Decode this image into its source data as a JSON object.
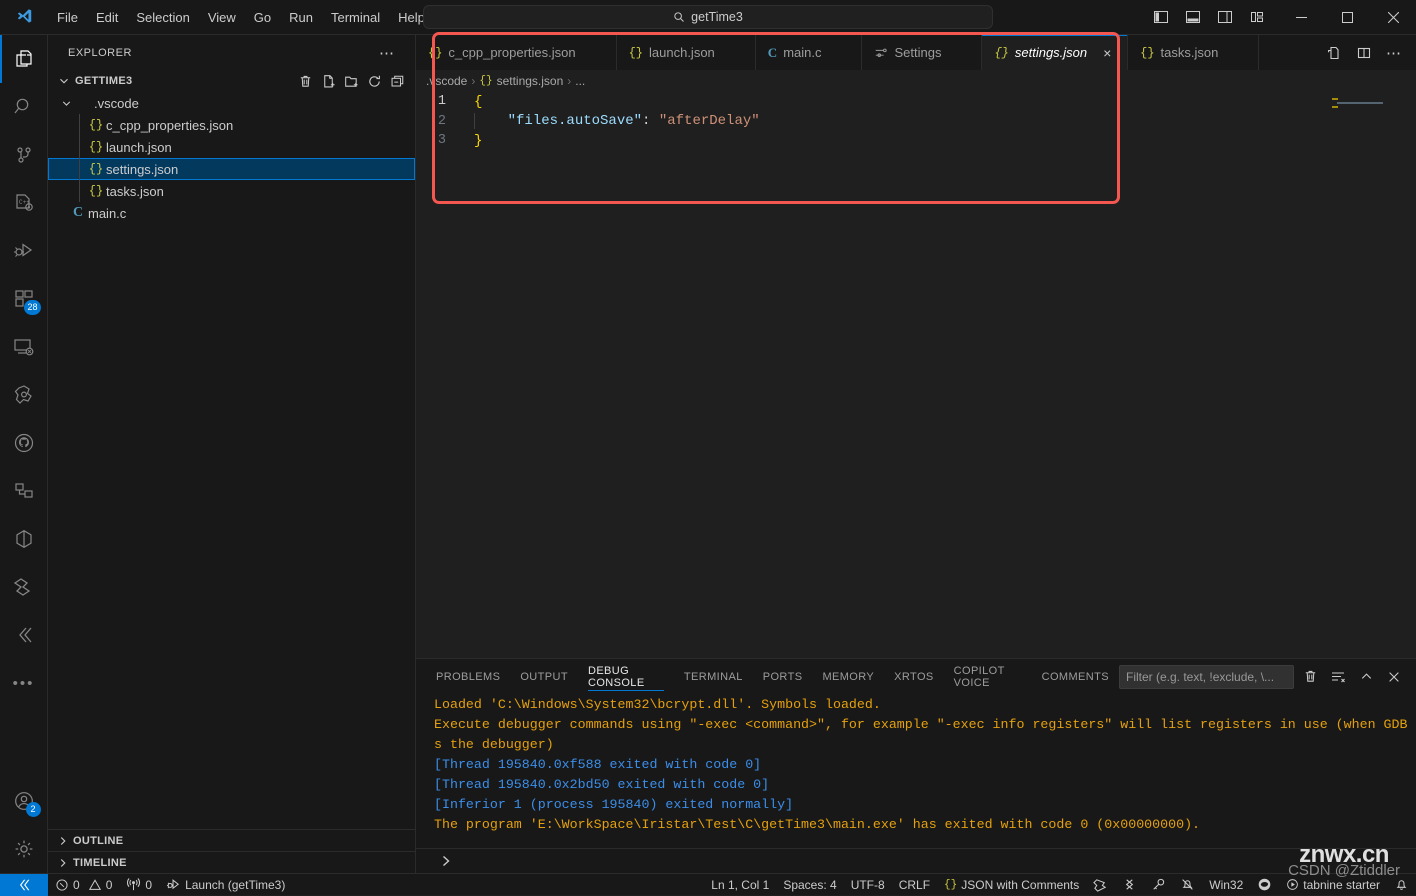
{
  "titlebar": {
    "menus": [
      "File",
      "Edit",
      "Selection",
      "View",
      "Go",
      "Run",
      "Terminal",
      "Help"
    ],
    "back_icon": "arrow-left-icon",
    "forward_icon": "arrow-right-icon",
    "command_center_text": "getTime3",
    "layout_icons": [
      "toggle-primary-sidebar-icon",
      "toggle-panel-icon",
      "toggle-secondary-sidebar-icon",
      "customize-layout-icon"
    ],
    "window_controls": [
      "minimize",
      "maximize",
      "close"
    ]
  },
  "activitybar": {
    "items": [
      {
        "name": "explorer",
        "icon": "files-icon",
        "active": true,
        "badge": ""
      },
      {
        "name": "search",
        "icon": "search-icon",
        "active": false,
        "badge": ""
      },
      {
        "name": "source-control",
        "icon": "source-control-icon",
        "active": false,
        "badge": ""
      },
      {
        "name": "cpp-config",
        "icon": "cpp-gear-icon",
        "active": false,
        "badge": ""
      },
      {
        "name": "run-and-debug",
        "icon": "debug-play-icon",
        "active": false,
        "badge": ""
      },
      {
        "name": "extensions",
        "icon": "extensions-icon",
        "active": false,
        "badge": "28"
      },
      {
        "name": "remote-explorer",
        "icon": "remote-monitor-icon",
        "active": false,
        "badge": ""
      },
      {
        "name": "platformio",
        "icon": "platformio-icon",
        "active": false,
        "badge": ""
      },
      {
        "name": "github",
        "icon": "github-icon",
        "active": false,
        "badge": ""
      },
      {
        "name": "project-manager",
        "icon": "project-manager-icon",
        "active": false,
        "badge": ""
      },
      {
        "name": "docker",
        "icon": "cube-icon",
        "active": false,
        "badge": ""
      },
      {
        "name": "serial-monitor",
        "icon": "serial-monitor-icon",
        "active": false,
        "badge": ""
      },
      {
        "name": "embedded-tools",
        "icon": "embedded-tools-icon",
        "active": false,
        "badge": ""
      },
      {
        "name": "more-views",
        "icon": "ellipsis-icon",
        "active": false,
        "badge": ""
      }
    ],
    "bottom": [
      {
        "name": "accounts",
        "icon": "account-icon",
        "badge": "2"
      },
      {
        "name": "manage",
        "icon": "gear-icon",
        "badge": ""
      }
    ]
  },
  "sidebar": {
    "title": "EXPLORER",
    "more_actions_icon": "ellipsis-icon",
    "root": {
      "label": "GETTIME3",
      "expanded": true,
      "actions": [
        "trash-icon",
        "new-file-icon",
        "new-folder-icon",
        "refresh-icon",
        "collapse-all-icon"
      ]
    },
    "tree": [
      {
        "label": ".vscode",
        "type": "folder",
        "depth": 1,
        "expanded": true,
        "selected": false
      },
      {
        "label": "c_cpp_properties.json",
        "type": "json",
        "depth": 2,
        "selected": false
      },
      {
        "label": "launch.json",
        "type": "json",
        "depth": 2,
        "selected": false
      },
      {
        "label": "settings.json",
        "type": "json",
        "depth": 2,
        "selected": true
      },
      {
        "label": "tasks.json",
        "type": "json",
        "depth": 2,
        "selected": false
      },
      {
        "label": "main.c",
        "type": "c",
        "depth": 1,
        "selected": false
      }
    ],
    "collapsed_sections": [
      {
        "label": "OUTLINE"
      },
      {
        "label": "TIMELINE"
      }
    ]
  },
  "editor": {
    "tabs": [
      {
        "label": "c_cpp_properties.json",
        "kind": "json",
        "active": false,
        "dirty": false
      },
      {
        "label": "launch.json",
        "kind": "json",
        "active": false,
        "dirty": false
      },
      {
        "label": "main.c",
        "kind": "c",
        "active": false,
        "dirty": false
      },
      {
        "label": "Settings",
        "kind": "settings",
        "active": false,
        "dirty": false
      },
      {
        "label": "settings.json",
        "kind": "json",
        "active": true,
        "dirty": false
      },
      {
        "label": "tasks.json",
        "kind": "json",
        "active": false,
        "dirty": false
      }
    ],
    "tab_close_label": "×",
    "tab_actions": [
      "split-editor-right-icon",
      "split-editor-icon",
      "more-actions-icon"
    ],
    "breadcrumbs": [
      ".vscode",
      "settings.json",
      "..."
    ],
    "breadcrumb_file_icon": "json-braces-icon",
    "code_lines": [
      {
        "num": "1",
        "tokens": [
          {
            "t": "{",
            "c": "tok-brace-y"
          }
        ]
      },
      {
        "num": "2",
        "tokens": [
          {
            "t": "    ",
            "c": "tok-punc"
          },
          {
            "t": "\"files.autoSave\"",
            "c": "tok-key"
          },
          {
            "t": ": ",
            "c": "tok-punc"
          },
          {
            "t": "\"afterDelay\"",
            "c": "tok-str"
          }
        ]
      },
      {
        "num": "3",
        "tokens": [
          {
            "t": "}",
            "c": "tok-brace-y"
          }
        ]
      }
    ]
  },
  "panel": {
    "tabs": [
      "PROBLEMS",
      "OUTPUT",
      "DEBUG CONSOLE",
      "TERMINAL",
      "PORTS",
      "MEMORY",
      "XRTOS",
      "COPILOT VOICE",
      "COMMENTS"
    ],
    "active_tab": "DEBUG CONSOLE",
    "filter_placeholder": "Filter (e.g. text, !exclude, \\...",
    "actions": [
      "clear-console-icon",
      "filter-icon",
      "chevron-up-icon",
      "close-icon"
    ],
    "console_lines": [
      {
        "text": "Loaded 'C:\\Windows\\System32\\bcrypt.dll'. Symbols loaded.",
        "color": "amber"
      },
      {
        "text": "Execute debugger commands using \"-exec <command>\", for example \"-exec info registers\" will list registers in use (when GDB i",
        "color": "amber"
      },
      {
        "text": "s the debugger)",
        "color": "amber"
      },
      {
        "text": "[Thread 195840.0xf588 exited with code 0]",
        "color": "blue"
      },
      {
        "text": "[Thread 195840.0x2bd50 exited with code 0]",
        "color": "blue"
      },
      {
        "text": "[Inferior 1 (process 195840) exited normally]",
        "color": "blue"
      },
      {
        "text": "The program 'E:\\WorkSpace\\Iristar\\Test\\C\\getTime3\\main.exe' has exited with code 0 (0x00000000).",
        "color": "amber"
      }
    ],
    "prompt_icon": "chevron-right-icon"
  },
  "statusbar": {
    "remote_icon": "remote-window-icon",
    "errors": "0",
    "warnings": "0",
    "radio_tower": "0",
    "launch_label": "Launch (getTime3)",
    "right": {
      "cursor": "Ln 1, Col 1",
      "indentation": "Spaces: 4",
      "encoding": "UTF-8",
      "eol": "CRLF",
      "language": "JSON with Comments",
      "platform": "Win32",
      "tabnine": "tabnine starter",
      "icons": [
        "prettier-icon",
        "sync-icon",
        "key-icon",
        "bell-slash-icon",
        "edge-icon",
        "tabnine-icon",
        "bell-icon"
      ]
    }
  },
  "annotation": {
    "color": "#f4574f",
    "shape": "rounded-rectangle"
  },
  "watermark": {
    "line1": "znwx.cn",
    "line2": "CSDN @Ztiddler"
  }
}
